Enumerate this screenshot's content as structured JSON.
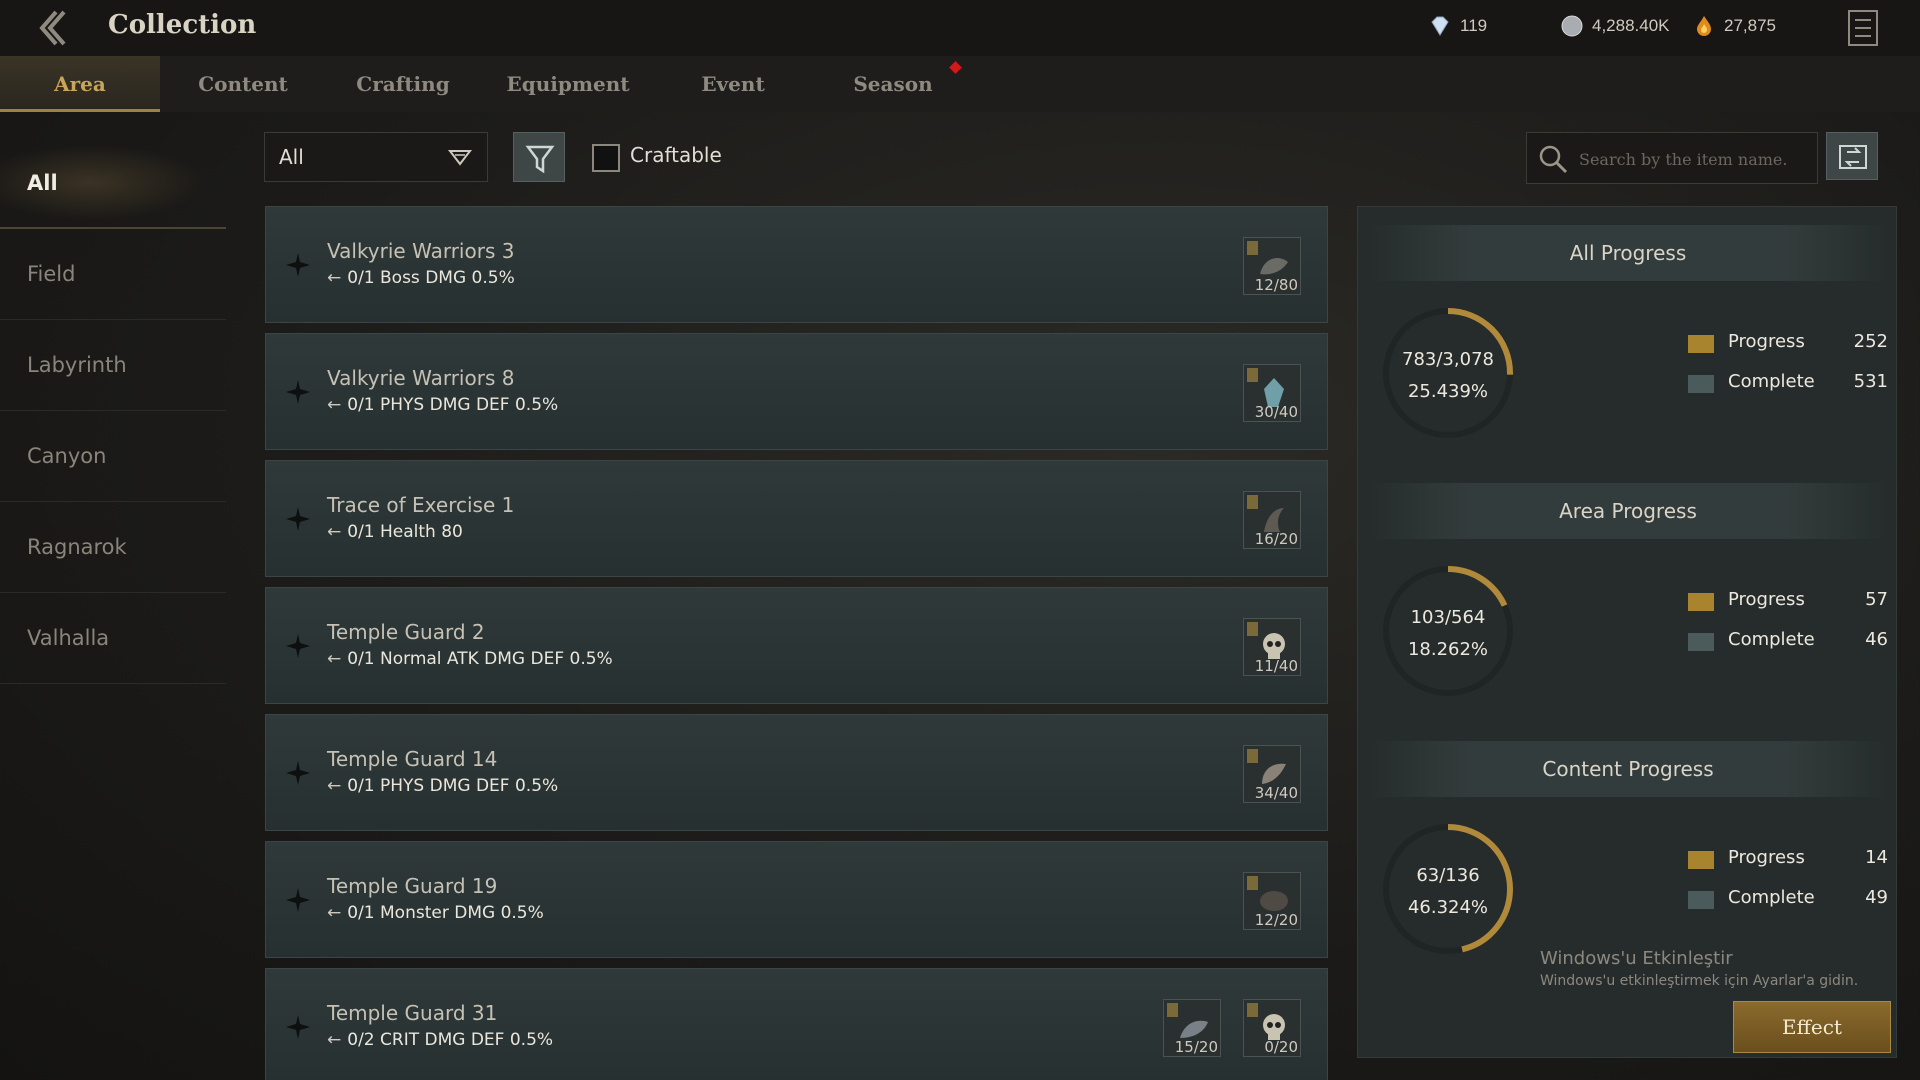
{
  "header": {
    "title": "Collection",
    "currencies": [
      {
        "icon": "diamond-icon",
        "value": "119"
      },
      {
        "icon": "silver-coin-icon",
        "value": "4,288.40K"
      },
      {
        "icon": "flame-icon",
        "value": "27,875"
      }
    ]
  },
  "tabs": [
    {
      "label": "Area",
      "active": true
    },
    {
      "label": "Content",
      "active": false
    },
    {
      "label": "Crafting",
      "active": false
    },
    {
      "label": "Equipment",
      "active": false
    },
    {
      "label": "Event",
      "active": false
    },
    {
      "label": "Season",
      "active": false
    }
  ],
  "sidebar": {
    "items": [
      {
        "label": "All",
        "active": true
      },
      {
        "label": "Field"
      },
      {
        "label": "Labyrinth"
      },
      {
        "label": "Canyon"
      },
      {
        "label": "Ragnarok"
      },
      {
        "label": "Valhalla"
      }
    ]
  },
  "filters": {
    "dropdown_value": "All",
    "craftable_label": "Craftable",
    "craftable_checked": false,
    "search_placeholder": "Search by the item name."
  },
  "collections": [
    {
      "name": "Valkyrie Warriors 3",
      "stat": "0/1 Boss DMG 0.5%",
      "materials": [
        {
          "icon": "wolf-pelt-icon",
          "count": "12/80"
        }
      ]
    },
    {
      "name": "Valkyrie Warriors 8",
      "stat": "0/1 PHYS DMG DEF 0.5%",
      "materials": [
        {
          "icon": "crystal-icon",
          "count": "30/40"
        }
      ]
    },
    {
      "name": "Trace of Exercise 1",
      "stat": "0/1 Health 80",
      "materials": [
        {
          "icon": "claw-icon",
          "count": "16/20"
        }
      ]
    },
    {
      "name": "Temple Guard 2",
      "stat": "0/1 Normal ATK DMG DEF 0.5%",
      "materials": [
        {
          "icon": "skull-icon",
          "count": "11/40"
        }
      ]
    },
    {
      "name": "Temple Guard 14",
      "stat": "0/1 PHYS DMG DEF 0.5%",
      "materials": [
        {
          "icon": "bone-icon",
          "count": "34/40"
        }
      ]
    },
    {
      "name": "Temple Guard 19",
      "stat": "0/1 Monster DMG 0.5%",
      "materials": [
        {
          "icon": "beast-hide-icon",
          "count": "12/20"
        }
      ]
    },
    {
      "name": "Temple Guard 31",
      "stat": "0/2 CRIT DMG DEF 0.5%",
      "materials": [
        {
          "icon": "scale-icon",
          "count": "15/20"
        },
        {
          "icon": "skull-icon",
          "count": "0/20"
        }
      ]
    }
  ],
  "progress": {
    "all": {
      "title": "All Progress",
      "fraction": "783/3,078",
      "percent": "25.439%",
      "ratio": 0.25439,
      "progress_label": "Progress",
      "progress_value": "252",
      "complete_label": "Complete",
      "complete_value": "531"
    },
    "area": {
      "title": "Area Progress",
      "fraction": "103/564",
      "percent": "18.262%",
      "ratio": 0.18262,
      "progress_label": "Progress",
      "progress_value": "57",
      "complete_label": "Complete",
      "complete_value": "46"
    },
    "content": {
      "title": "Content Progress",
      "fraction": "63/136",
      "percent": "46.324%",
      "ratio": 0.46324,
      "progress_label": "Progress",
      "progress_value": "14",
      "complete_label": "Complete",
      "complete_value": "49"
    }
  },
  "colors": {
    "gold": "#c9a55a",
    "progress_swatch": "#a8842f",
    "complete_swatch": "#4b5a5a",
    "ring_track": "#1f2424",
    "ring_gold": "#b08a3a",
    "ring_teal": "#5a6a6a"
  },
  "windows_notice": {
    "line1": "Windows'u Etkinleştir",
    "line2": "Windows'u etkinleştirmek için Ayarlar'a gidin."
  },
  "effect_button": "Effect"
}
